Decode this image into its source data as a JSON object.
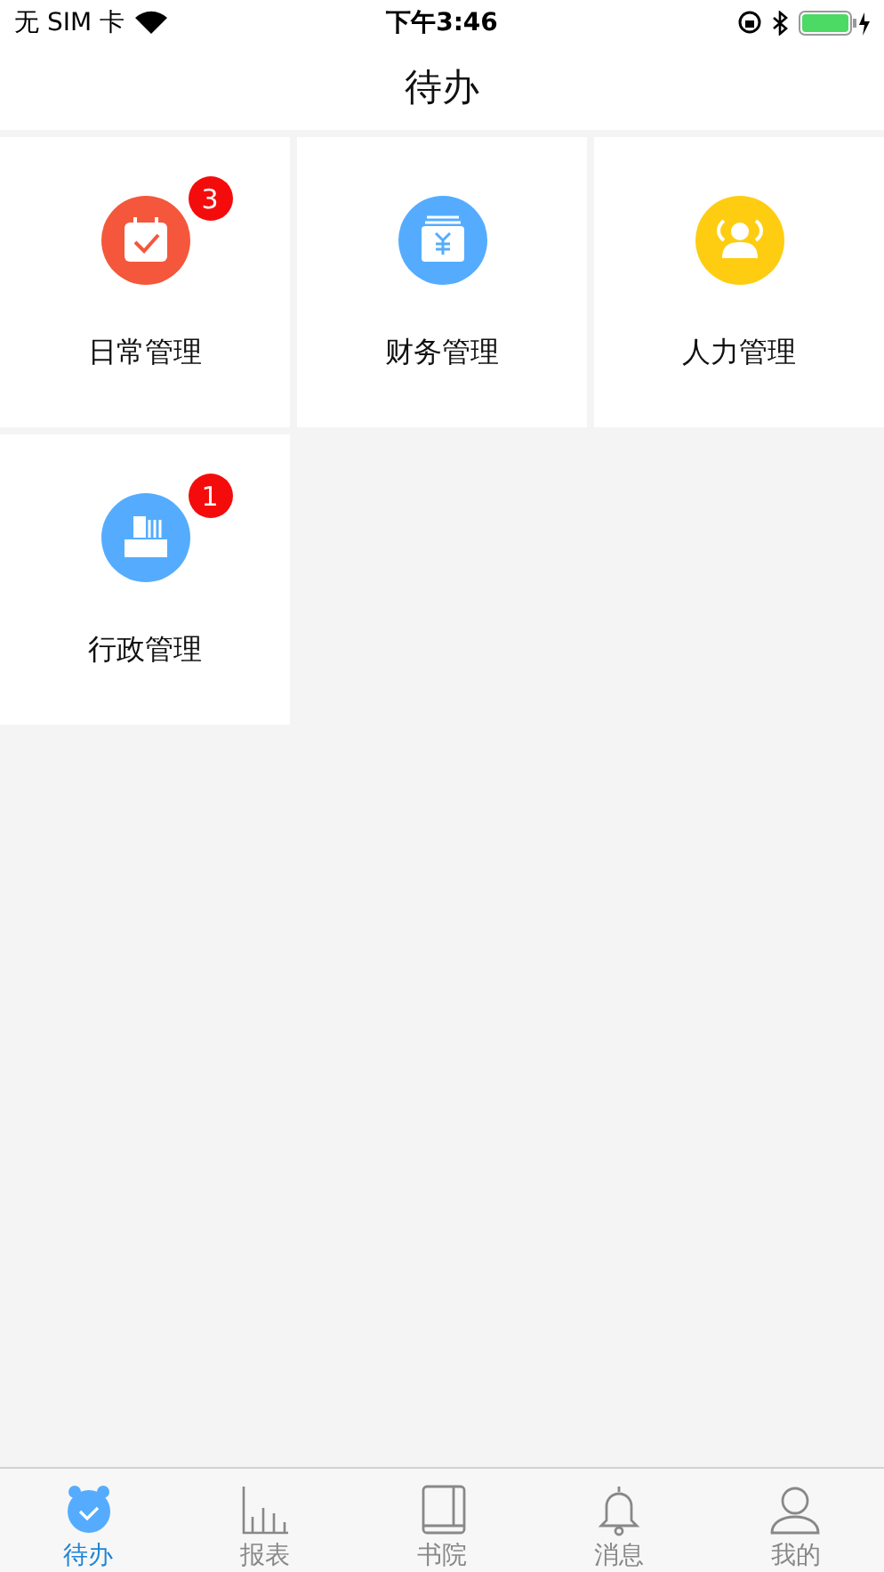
{
  "status_bar": {
    "carrier": "无 SIM 卡",
    "time": "下午3:46"
  },
  "nav": {
    "title": "待办"
  },
  "tiles": [
    {
      "label": "日常管理",
      "kind": "calendar",
      "color": "#f4573b",
      "badge": "3"
    },
    {
      "label": "财务管理",
      "kind": "money",
      "color": "#55acfe"
    },
    {
      "label": "人力管理",
      "kind": "people",
      "color": "#fecd12"
    },
    {
      "label": "行政管理",
      "kind": "tray",
      "color": "#55acfe",
      "badge": "1"
    }
  ],
  "tabs": [
    {
      "label": "待办",
      "kind": "clock",
      "selected": true
    },
    {
      "label": "报表",
      "kind": "chart",
      "selected": false
    },
    {
      "label": "书院",
      "kind": "book",
      "selected": false
    },
    {
      "label": "消息",
      "kind": "bell",
      "selected": false
    },
    {
      "label": "我的",
      "kind": "person",
      "selected": false
    }
  ]
}
